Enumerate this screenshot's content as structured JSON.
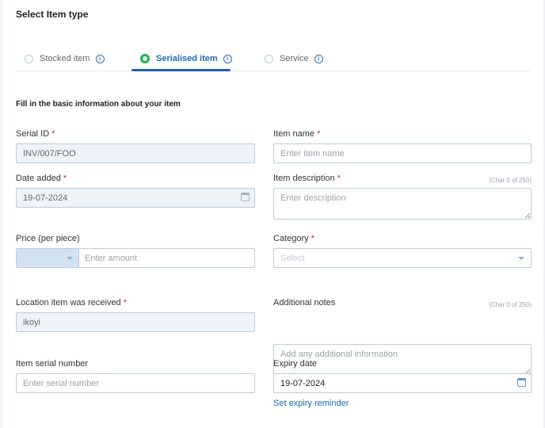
{
  "section": {
    "title": "Select Item type"
  },
  "item_types": [
    {
      "label": "Stocked item",
      "selected": false
    },
    {
      "label": "Serialised item",
      "selected": true
    },
    {
      "label": "Service",
      "selected": false
    }
  ],
  "info_glyph": "i",
  "form": {
    "subtitle": "Fill in the basic information about your item",
    "required_mark": "*",
    "serial_id": {
      "label": "Serial ID",
      "value": "INV/007/FOO"
    },
    "item_name": {
      "label": "Item name",
      "placeholder": "Enter item name"
    },
    "date_added": {
      "label": "Date added",
      "value": "19-07-2024"
    },
    "item_description": {
      "label": "Item description",
      "counter": "(Char 0 of 250)",
      "placeholder": "Enter description"
    },
    "price": {
      "label": "Price (per piece)",
      "currency_value": "",
      "placeholder": "Enter amount"
    },
    "category": {
      "label": "Category",
      "placeholder": "Select"
    },
    "location": {
      "label": "Location item was received",
      "value": "ikoyi"
    },
    "additional_notes": {
      "label": "Additional notes",
      "counter": "(Char 0 of 250)",
      "placeholder": "Add any additional information"
    },
    "item_serial_number": {
      "label": "Item serial number",
      "placeholder": "Enter serial number"
    },
    "expiry_date": {
      "label": "Expiry date",
      "value": "19-07-2024",
      "reminder_link": "Set expiry reminder"
    }
  }
}
